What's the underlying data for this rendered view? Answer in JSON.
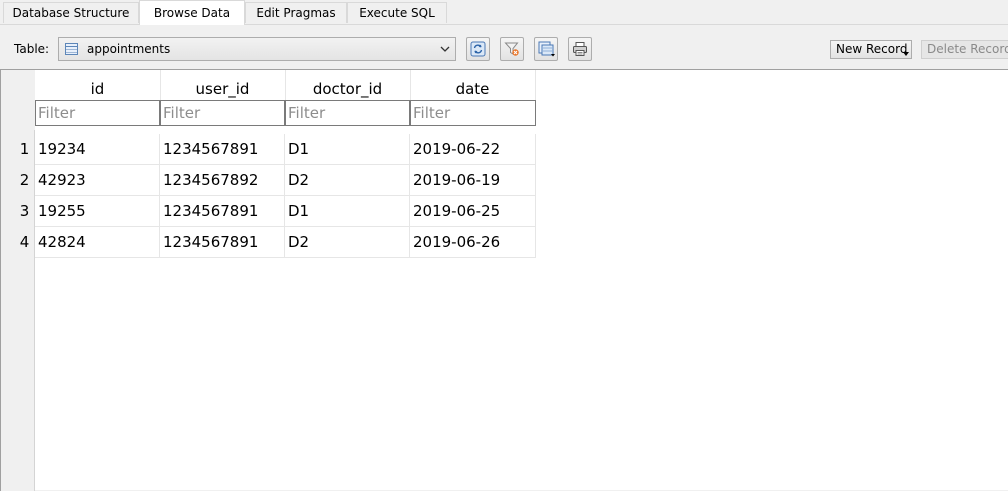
{
  "tabs": [
    {
      "label": "Database Structure"
    },
    {
      "label": "Browse Data"
    },
    {
      "label": "Edit Pragmas"
    },
    {
      "label": "Execute SQL"
    }
  ],
  "toolbar": {
    "table_label": "Table:",
    "table_value": "appointments",
    "new_record_label": "New Record",
    "delete_record_label": "Delete Record"
  },
  "grid": {
    "columns": [
      "id",
      "user_id",
      "doctor_id",
      "date"
    ],
    "filter_placeholder": "Filter",
    "rows": [
      {
        "num": "1",
        "cells": [
          "19234",
          "1234567891",
          "D1",
          "2019-06-22"
        ]
      },
      {
        "num": "2",
        "cells": [
          "42923",
          "1234567892",
          "D2",
          "2019-06-19"
        ]
      },
      {
        "num": "3",
        "cells": [
          "19255",
          "1234567891",
          "D1",
          "2019-06-25"
        ]
      },
      {
        "num": "4",
        "cells": [
          "42824",
          "1234567891",
          "D2",
          "2019-06-26"
        ]
      }
    ]
  },
  "icons": {
    "refresh": "refresh-icon",
    "clear_filters": "filter-clear-icon",
    "save_table": "save-table-icon",
    "print": "printer-icon"
  }
}
